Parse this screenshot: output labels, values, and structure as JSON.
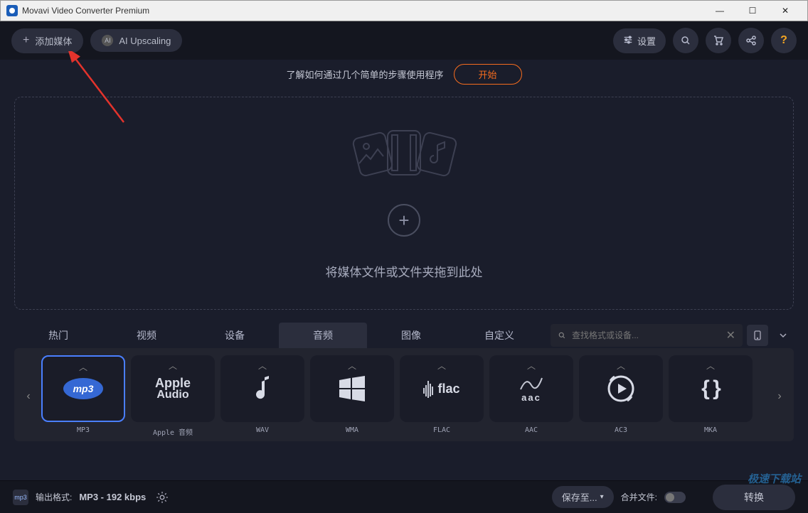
{
  "title": "Movavi Video Converter Premium",
  "topbar": {
    "add_media": "添加媒体",
    "ai_upscaling": "AI Upscaling",
    "settings": "设置"
  },
  "promo": {
    "text": "了解如何通过几个简单的步骤使用程序",
    "start": "开始"
  },
  "dropzone": {
    "text": "将媒体文件或文件夹拖到此处"
  },
  "tabs": [
    {
      "label": "热门",
      "active": false
    },
    {
      "label": "视频",
      "active": false
    },
    {
      "label": "设备",
      "active": false
    },
    {
      "label": "音频",
      "active": true
    },
    {
      "label": "图像",
      "active": false
    },
    {
      "label": "自定义",
      "active": false
    }
  ],
  "search": {
    "placeholder": "查找格式或设备..."
  },
  "formats": [
    {
      "name": "MP3",
      "label": "MP3",
      "selected": true
    },
    {
      "name": "Apple Audio",
      "label": "Apple 音频",
      "selected": false
    },
    {
      "name": "WAV",
      "label": "WAV",
      "selected": false
    },
    {
      "name": "WMA",
      "label": "WMA",
      "selected": false
    },
    {
      "name": "FLAC",
      "label": "FLAC",
      "selected": false
    },
    {
      "name": "AAC",
      "label": "AAC",
      "selected": false
    },
    {
      "name": "AC3",
      "label": "AC3",
      "selected": false
    },
    {
      "name": "MKA",
      "label": "MKA",
      "selected": false
    }
  ],
  "bottom": {
    "output_label": "输出格式:",
    "output_value": "MP3 - 192 kbps",
    "save_to": "保存至...",
    "merge": "合并文件:",
    "convert": "转换"
  },
  "watermark": "极速下载站"
}
